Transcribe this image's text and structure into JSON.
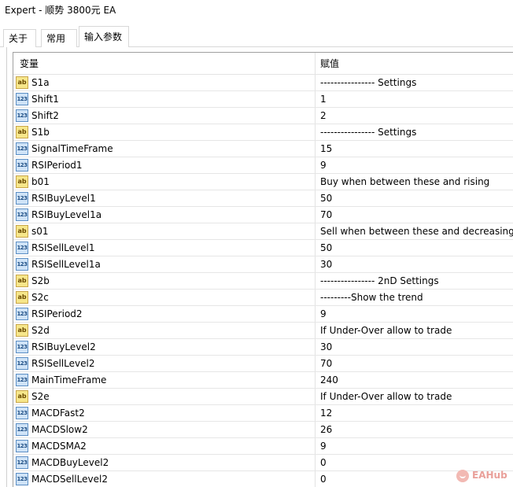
{
  "window": {
    "title": "Expert - 顺势 3800元 EA"
  },
  "tabs": [
    {
      "label": "关于"
    },
    {
      "label": "常用"
    },
    {
      "label": "输入参数"
    }
  ],
  "table": {
    "headers": {
      "variable": "变量",
      "value": "赋值"
    },
    "icons": {
      "string": "ab",
      "number": "123"
    },
    "rows": [
      {
        "type": "string",
        "name": "S1a",
        "value": "---------------- Settings"
      },
      {
        "type": "number",
        "name": "Shift1",
        "value": "1"
      },
      {
        "type": "number",
        "name": "Shift2",
        "value": "2"
      },
      {
        "type": "string",
        "name": "S1b",
        "value": "---------------- Settings"
      },
      {
        "type": "number",
        "name": "SignalTimeFrame",
        "value": "15"
      },
      {
        "type": "number",
        "name": "RSIPeriod1",
        "value": "9"
      },
      {
        "type": "string",
        "name": "b01",
        "value": "Buy when between these and rising"
      },
      {
        "type": "number",
        "name": "RSIBuyLevel1",
        "value": "50"
      },
      {
        "type": "number",
        "name": "RSIBuyLevel1a",
        "value": "70"
      },
      {
        "type": "string",
        "name": "s01",
        "value": "Sell when between these and decreasing"
      },
      {
        "type": "number",
        "name": "RSISellLevel1",
        "value": "50"
      },
      {
        "type": "number",
        "name": "RSISellLevel1a",
        "value": "30"
      },
      {
        "type": "string",
        "name": "S2b",
        "value": "---------------- 2nD Settings"
      },
      {
        "type": "string",
        "name": "S2c",
        "value": "---------Show the trend"
      },
      {
        "type": "number",
        "name": "RSIPeriod2",
        "value": "9"
      },
      {
        "type": "string",
        "name": "S2d",
        "value": "If Under-Over allow to trade"
      },
      {
        "type": "number",
        "name": "RSIBuyLevel2",
        "value": "30"
      },
      {
        "type": "number",
        "name": "RSISellLevel2",
        "value": "70"
      },
      {
        "type": "number",
        "name": "MainTimeFrame",
        "value": "240"
      },
      {
        "type": "string",
        "name": "S2e",
        "value": "If Under-Over allow to trade"
      },
      {
        "type": "number",
        "name": "MACDFast2",
        "value": "12"
      },
      {
        "type": "number",
        "name": "MACDSlow2",
        "value": "26"
      },
      {
        "type": "number",
        "name": "MACDSMA2",
        "value": "9"
      },
      {
        "type": "number",
        "name": "MACDBuyLevel2",
        "value": "0"
      },
      {
        "type": "number",
        "name": "MACDSellLevel2",
        "value": "0"
      }
    ]
  },
  "watermark": {
    "text": "EAHub"
  }
}
